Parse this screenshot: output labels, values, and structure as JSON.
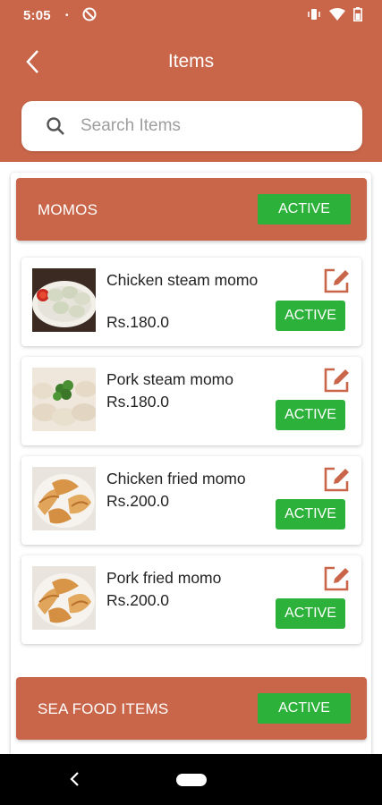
{
  "status_bar": {
    "time": "5:05",
    "icons": [
      "notification-dot",
      "at-sign-icon",
      "vibrate-icon",
      "wifi-icon",
      "battery-icon"
    ]
  },
  "header": {
    "title": "Items",
    "back_icon": "chevron-left-icon"
  },
  "search": {
    "placeholder": "Search Items",
    "value": "",
    "icon": "search-icon"
  },
  "categories": [
    {
      "title": "MOMOS",
      "status_label": "ACTIVE",
      "items": [
        {
          "name": "Chicken steam momo",
          "price": "Rs.180.0",
          "status_label": "ACTIVE",
          "image": "steam-momo-with-sauce"
        },
        {
          "name": "Pork steam momo",
          "price": "Rs.180.0",
          "status_label": "ACTIVE",
          "image": "steam-momo-with-parsley"
        },
        {
          "name": "Chicken fried momo",
          "price": "Rs.200.0",
          "status_label": "ACTIVE",
          "image": "fried-momo"
        },
        {
          "name": "Pork fried momo",
          "price": "Rs.200.0",
          "status_label": "ACTIVE",
          "image": "fried-momo"
        }
      ]
    },
    {
      "title": "SEA FOOD ITEMS",
      "status_label": "ACTIVE",
      "items": []
    }
  ],
  "colors": {
    "primary": "#c9664a",
    "active_green": "#2cb23a",
    "text_dark": "#222222",
    "placeholder": "#9e9e9e"
  },
  "nav_bar": {
    "icons": [
      "nav-back-icon",
      "nav-home-pill"
    ]
  }
}
